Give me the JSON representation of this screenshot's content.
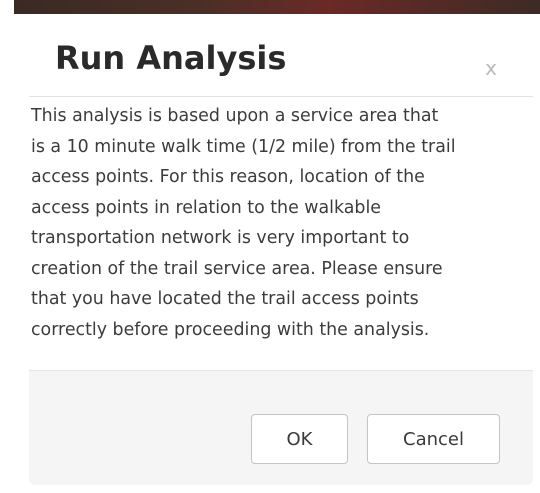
{
  "dialog": {
    "title": "Run Analysis",
    "close_label": "x",
    "message": "This analysis is based upon a service area that\nis a 10 minute walk time (1/2 mile) from the trail\naccess points. For this reason, location of the\naccess points in relation to the walkable\ntransportation network is very important to\ncreation of the trail service area. Please ensure\nthat you have located the trail access points\ncorrectly before proceeding with the analysis.",
    "ok_label": "OK",
    "cancel_label": "Cancel"
  }
}
